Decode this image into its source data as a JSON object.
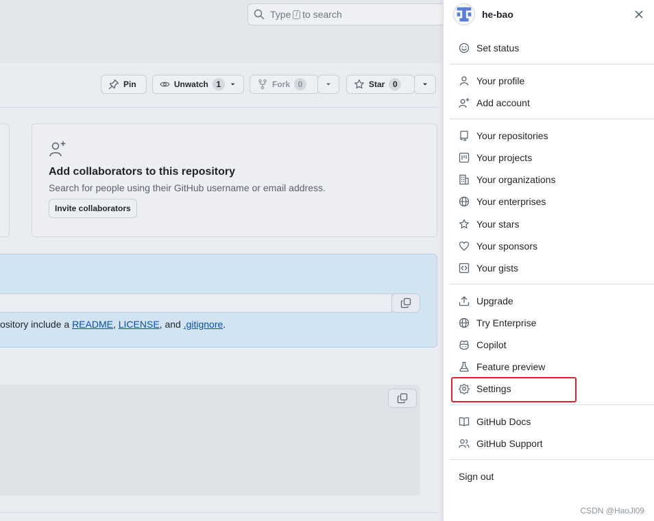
{
  "search": {
    "prefix": "Type",
    "key": "/",
    "suffix": "to search"
  },
  "repo_actions": {
    "pin": "Pin",
    "unwatch": "Unwatch",
    "unwatch_count": "1",
    "fork": "Fork",
    "fork_count": "0",
    "star": "Star",
    "star_count": "0"
  },
  "collaborators": {
    "title": "Add collaborators to this repository",
    "description": "Search for people using their GitHub username or email address.",
    "invite_label": "Invite collaborators"
  },
  "setup": {
    "text_prefix": "ository include a ",
    "readme": "README",
    "sep1": ", ",
    "license": "LICENSE",
    "sep2": ", and ",
    "gitignore": ".gitignore",
    "end": "."
  },
  "user_menu": {
    "username": "he-bao",
    "set_status": "Set status",
    "your_profile": "Your profile",
    "add_account": "Add account",
    "your_repositories": "Your repositories",
    "your_projects": "Your projects",
    "your_organizations": "Your organizations",
    "your_enterprises": "Your enterprises",
    "your_stars": "Your stars",
    "your_sponsors": "Your sponsors",
    "your_gists": "Your gists",
    "upgrade": "Upgrade",
    "try_enterprise": "Try Enterprise",
    "copilot": "Copilot",
    "feature_preview": "Feature preview",
    "settings": "Settings",
    "github_docs": "GitHub Docs",
    "github_support": "GitHub Support",
    "sign_out": "Sign out"
  },
  "watermark": "CSDN @HaoJl09",
  "colors": {
    "highlight": "#e5202e",
    "link": "#0550ae",
    "setup_bg": "#d2e4f2"
  }
}
